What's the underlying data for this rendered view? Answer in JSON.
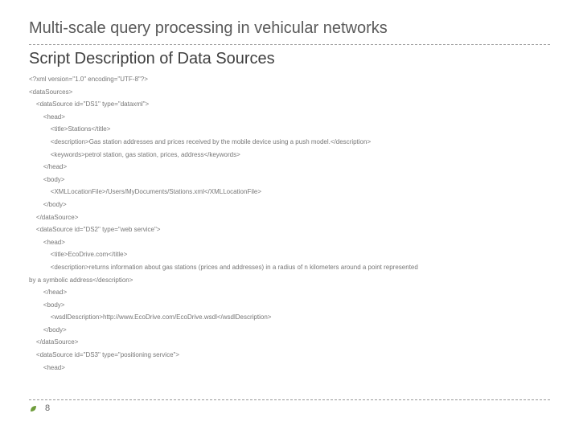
{
  "header": {
    "main_title": "Multi-scale query processing in vehicular networks",
    "sub_title": "Script Description of Data Sources"
  },
  "code": {
    "lines": [
      "<?xml version=\"1.0\" encoding=\"UTF-8\"?>",
      "<dataSources>",
      "    <dataSource id=\"DS1\" type=\"dataxml\">",
      "        <head>",
      "            <title>Stations</title>",
      "            <description>Gas station addresses and prices received by the mobile device using a push model.</description>",
      "            <keywords>petrol station, gas station, prices, address</keywords>",
      "        </head>",
      "        <body>",
      "            <XMLLocationFile>/Users/MyDocuments/Stations.xml</XMLLocationFile>",
      "        </body>",
      "    </dataSource>",
      "    <dataSource id=\"DS2\" type=\"web service\">",
      "        <head>",
      "            <title>EcoDrive.com</title>",
      "            <description>returns information about gas stations (prices and addresses) in a radius of n kilometers around a point represented",
      "by a symbolic address</description>",
      "        </head>",
      "        <body>",
      "            <wsdlDescription>http://www.EcoDrive.com/EcoDrive.wsdl</wsdlDescription>",
      "        </body>",
      "    </dataSource>",
      "    <dataSource id=\"DS3\" type=\"positioning service\">",
      "        <head>"
    ]
  },
  "footer": {
    "page_number": "8",
    "bullet_color": "#6e9c3a"
  }
}
